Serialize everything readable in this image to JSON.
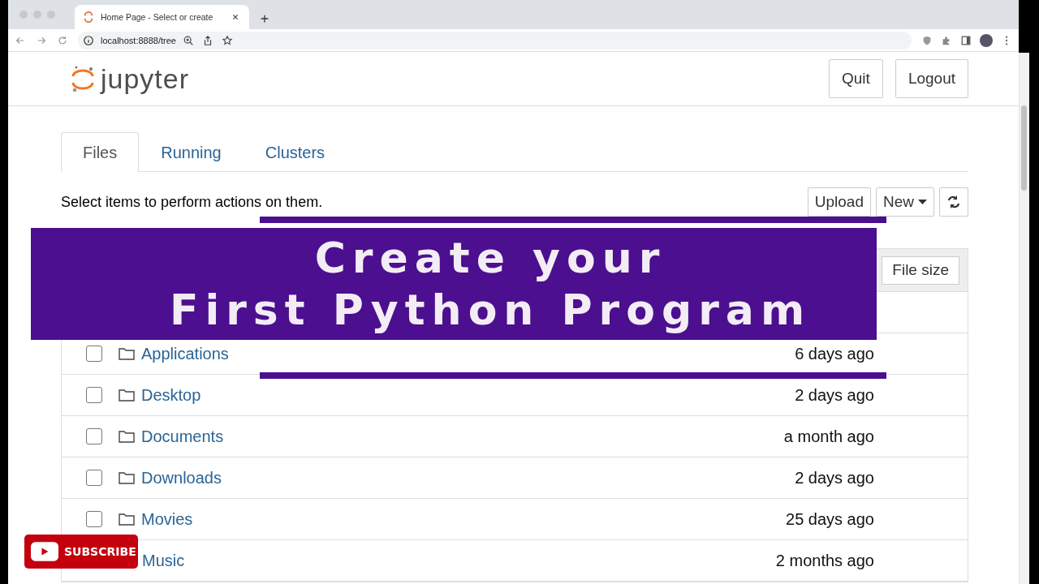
{
  "browser": {
    "tab_title": "Home Page - Select or create",
    "url": "localhost:8888/tree"
  },
  "header": {
    "logo_text": "jupyter",
    "buttons": [
      "Quit",
      "Logout"
    ]
  },
  "tabs": [
    {
      "label": "Files",
      "selected": true
    },
    {
      "label": "Running",
      "selected": false
    },
    {
      "label": "Clusters",
      "selected": false
    }
  ],
  "toolbar": {
    "instruction": "Select items to perform actions on them.",
    "buttons": [
      {
        "label": "Upload",
        "kind": "plain"
      },
      {
        "label": "New",
        "kind": "dropdown"
      },
      {
        "kind": "refresh"
      }
    ]
  },
  "table": {
    "sort_button": "File size",
    "rows": [
      {
        "name": "Applications",
        "modified": "6 days ago",
        "checked": false
      },
      {
        "name": "Desktop",
        "modified": "2 days ago",
        "checked": false
      },
      {
        "name": "Documents",
        "modified": "a month ago",
        "checked": false
      },
      {
        "name": "Downloads",
        "modified": "2 days ago",
        "checked": false
      },
      {
        "name": "Movies",
        "modified": "25 days ago",
        "checked": false
      },
      {
        "name": "Music",
        "modified": "2 months ago"
      }
    ]
  },
  "overlay": {
    "title_lines": [
      "Create your",
      "First Python Program"
    ],
    "subscribe": "SUBSCRIBE"
  }
}
